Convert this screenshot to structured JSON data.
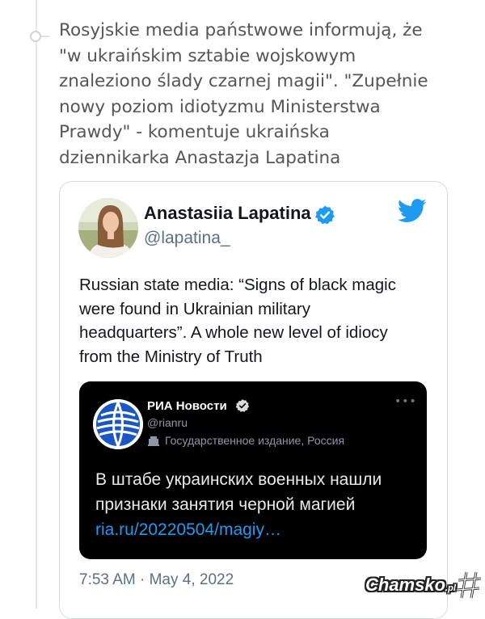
{
  "post": {
    "lines": [
      "Rosyjskie media państwowe informują, że",
      "\"w ukraińskim sztabie wojskowym",
      "znaleziono ślady czarnej magii\". \"Zupełnie",
      "nowy poziom idiotyzmu Ministerstwa",
      "Prawdy\" - komentuje ukraińska",
      "dziennikarka Anastazja Lapatina"
    ]
  },
  "tweet": {
    "author_name": "Anastasiia Lapatina",
    "author_handle": "@lapatina_",
    "body_lines": [
      "Russian state media: “Signs of black magic",
      "were found in Ukrainian military",
      "headquarters”. A whole new level of idiocy",
      "from the Ministry of Truth"
    ],
    "timestamp": "7:53 AM · May 4, 2022",
    "colors": {
      "verified": "#1d9bf0",
      "twitter_brand": "#1d9bf0"
    }
  },
  "embed": {
    "name": "РИА Новости",
    "handle": "@rianru",
    "label": "Государственное издание, Россия",
    "more_icon": "ellipsis-icon",
    "text_lines": [
      "В штабе украинских военных нашли",
      "признаки занятия черной магией"
    ],
    "link": "ria.ru/20220504/magiy…"
  },
  "watermark": {
    "main": "Chamsko",
    "suffix": ".pl"
  }
}
